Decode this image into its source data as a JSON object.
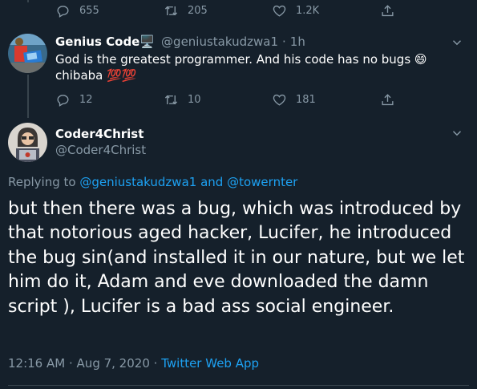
{
  "previous_tweet": {
    "replies": "655",
    "retweets": "205",
    "likes": "1.2K"
  },
  "reply_tweet": {
    "display_name": "Genius Code",
    "name_emoji": "🖥️",
    "handle": "@geniustakudzwa1",
    "separator": "·",
    "time": "1h",
    "text": "God is the greatest programmer. And his code has no bugs 😄 chibaba 💯💯",
    "replies": "12",
    "retweets": "10",
    "likes": "181"
  },
  "main_tweet": {
    "display_name": "Coder4Christ",
    "handle": "@Coder4Christ",
    "replying_prefix": "Replying to",
    "reply_to_1": "@geniustakudzwa1",
    "reply_and": "and",
    "reply_to_2": "@towernter",
    "text": "but then there was a bug, which was introduced by that notorious aged hacker, Lucifer, he introduced the bug sin(and installed it in our nature, but we let him do it, Adam and eve downloaded the damn script ), Lucifer is a bad ass social engineer.",
    "time": "12:16 AM",
    "dot": "·",
    "date": "Aug 7, 2020",
    "source": "Twitter Web App"
  },
  "colors": {
    "background": "#15202b",
    "secondary_text": "#8899a6",
    "link": "#1da1f2",
    "thread_line": "#38444d"
  }
}
